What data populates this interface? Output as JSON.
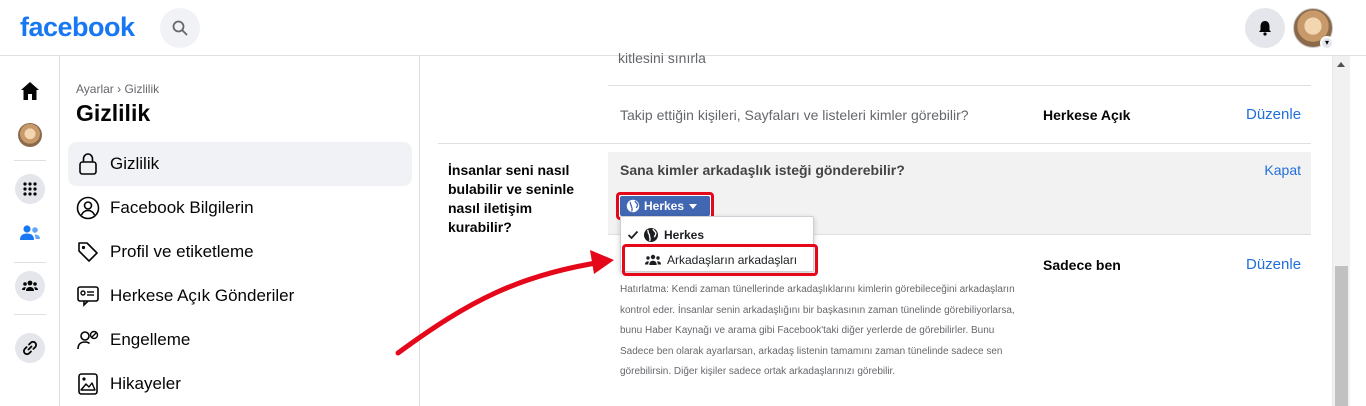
{
  "topbar": {
    "logo": "facebook"
  },
  "sidebar": {
    "breadcrumb": "Ayarlar › Gizlilik",
    "title": "Gizlilik",
    "items": [
      {
        "label": "Gizlilik",
        "icon": "lock-icon",
        "active": true
      },
      {
        "label": "Facebook Bilgilerin",
        "icon": "person-circle-icon"
      },
      {
        "label": "Profil ve etiketleme",
        "icon": "tag-icon"
      },
      {
        "label": "Herkese Açık Gönderiler",
        "icon": "public-posts-icon"
      },
      {
        "label": "Engelleme",
        "icon": "block-user-icon"
      },
      {
        "label": "Hikayeler",
        "icon": "stories-icon"
      }
    ]
  },
  "main": {
    "top_cut_text": "kitlesini sınırla",
    "follow_row": {
      "question": "Takip ettiğin kişileri, Sayfaları ve listeleri kimler görebilir?",
      "value": "Herkese Açık",
      "edit": "Düzenle"
    },
    "section_label": "İnsanlar seni nasıl bulabilir ve seninle nasıl iletişim kurabilir?",
    "friend_request": {
      "title": "Sana kimler arkadaşlık isteği gönderebilir?",
      "close": "Kapat",
      "button_label": "Herkes",
      "options": [
        "Herkes",
        "Arkadaşların arkadaşları"
      ]
    },
    "friends_list_row": {
      "value": "Sadece ben",
      "edit": "Düzenle",
      "reminder": "Hatırlatma: Kendi zaman tünellerinde arkadaşlıklarını kimlerin görebileceğini arkadaşların kontrol eder. İnsanlar senin arkadaşlığını bir başkasının zaman tünelinde görebiliyorlarsa, bunu Haber Kaynağı ve arama gibi Facebook'taki diğer yerlerde de görebilirler. Bunu Sadece ben olarak ayarlarsan, arkadaş listenin tamamını zaman tünelinde sadece sen görebilirsin. Diğer kişiler sadece ortak arkadaşlarınızı görebilir."
    }
  },
  "colors": {
    "brand": "#1877f2",
    "link": "#216fdb",
    "highlight_red": "#e5081b",
    "button_blue": "#4267b2"
  }
}
